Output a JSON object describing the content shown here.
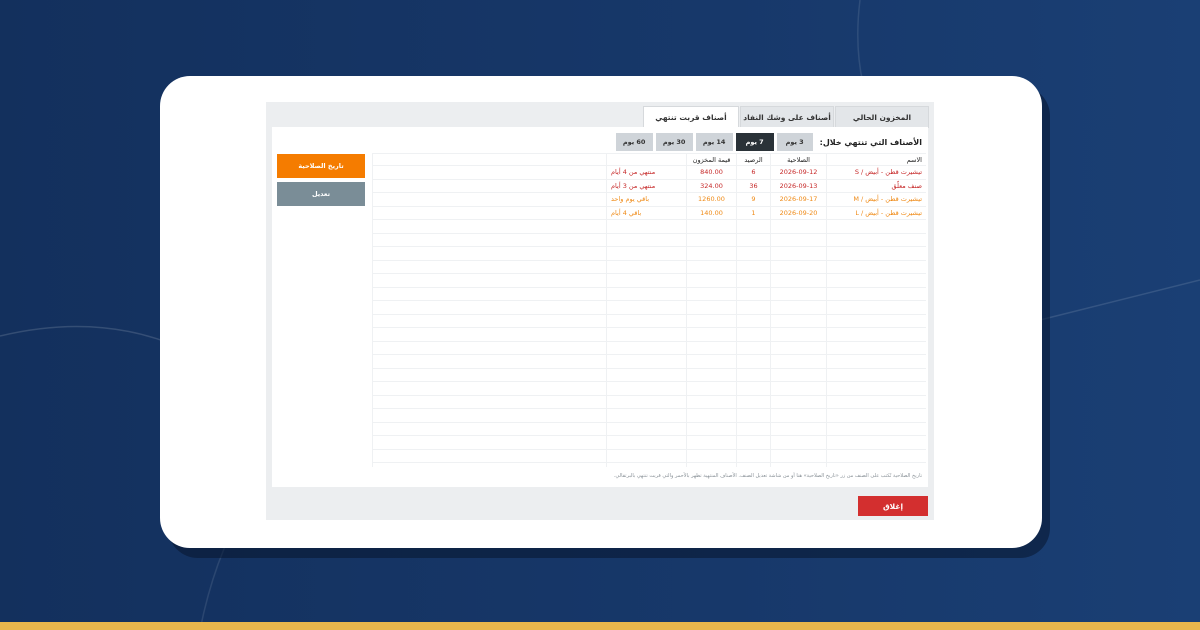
{
  "tabs": [
    {
      "label": "المخزون الحالي",
      "active": false
    },
    {
      "label": "أصناف على وشك النفاد",
      "active": false
    },
    {
      "label": "أصناف قربت تنتهي",
      "active": true
    }
  ],
  "filter": {
    "label": "الأصناف التي تنتهي خلال:",
    "options": [
      {
        "label": "3 يوم",
        "active": false
      },
      {
        "label": "7 يوم",
        "active": true
      },
      {
        "label": "14 يوم",
        "active": false
      },
      {
        "label": "30 يوم",
        "active": false
      },
      {
        "label": "60 يوم",
        "active": false
      }
    ]
  },
  "side_buttons": {
    "expiry": "تاريخ الصلاحية",
    "edit": "تعديل"
  },
  "table": {
    "headers": {
      "name": "الاسم",
      "expiry": "الصلاحية",
      "balance": "الرصيد",
      "value": "قيمة المخزون",
      "status": ""
    },
    "rows": [
      {
        "name": "تيشيرت قطن - أبيض / S",
        "expiry": "2026-09-12",
        "balance": "6",
        "value": "840.00",
        "status": "منتهي من 4 أيام",
        "tone": "expired"
      },
      {
        "name": "صنف معلّق",
        "expiry": "2026-09-13",
        "balance": "36",
        "value": "324.00",
        "status": "منتهي من 3 أيام",
        "tone": "expired"
      },
      {
        "name": "تيشيرت قطن - أبيض / M",
        "expiry": "2026-09-17",
        "balance": "9",
        "value": "1260.00",
        "status": "باقي يوم واحد",
        "tone": "warn"
      },
      {
        "name": "تيشيرت قطن - أبيض / L",
        "expiry": "2026-09-20",
        "balance": "1",
        "value": "140.00",
        "status": "باقي 4 أيام",
        "tone": "warn"
      }
    ]
  },
  "note": "تاريخ الصلاحية تُكتب على الصنف من زر «تاريخ الصلاحية» هنا أو من شاشة تعديل الصنف. الأصناف المنتهية تظهر بالأحمر والتي قربت تنتهي بالبرتقالي.",
  "footer": {
    "close_label": "إغلاق"
  },
  "colors": {
    "background": "#17386a",
    "accent_orange": "#f57c00",
    "danger_red": "#d32f2f",
    "chip_active": "#2a3238",
    "bottom_strip": "#e8b64c"
  }
}
